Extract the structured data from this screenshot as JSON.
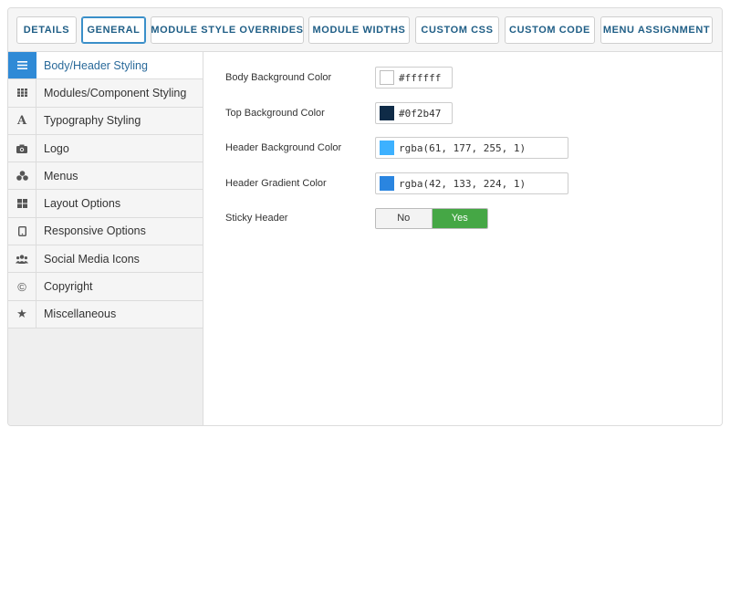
{
  "tabs": [
    {
      "label": "Details"
    },
    {
      "label": "General",
      "active": true
    },
    {
      "label": "Module Style Overrides"
    },
    {
      "label": "Module Widths"
    },
    {
      "label": "Custom CSS"
    },
    {
      "label": "Custom Code"
    },
    {
      "label": "Menu Assignment"
    }
  ],
  "sidebar": {
    "items": [
      {
        "label": "Body/Header Styling",
        "icon": "hamburger-icon",
        "active": true
      },
      {
        "label": "Modules/Component Styling",
        "icon": "grid-icon"
      },
      {
        "label": "Typography Styling",
        "icon": "font-icon"
      },
      {
        "label": "Logo",
        "icon": "camera-icon"
      },
      {
        "label": "Menus",
        "icon": "cubes-icon"
      },
      {
        "label": "Layout Options",
        "icon": "layout-icon"
      },
      {
        "label": "Responsive Options",
        "icon": "tablet-icon"
      },
      {
        "label": "Social Media Icons",
        "icon": "users-icon"
      },
      {
        "label": "Copyright",
        "icon": "copyright-icon"
      },
      {
        "label": "Miscellaneous",
        "icon": "star-icon"
      }
    ]
  },
  "form": {
    "body_bg": {
      "label": "Body Background Color",
      "value": "#ffffff",
      "swatch": "#ffffff"
    },
    "top_bg": {
      "label": "Top Background Color",
      "value": "#0f2b47",
      "swatch": "#0f2b47"
    },
    "header_bg": {
      "label": "Header Background Color",
      "value": "rgba(61, 177, 255, 1)",
      "swatch": "#3db1ff"
    },
    "header_gradient": {
      "label": "Header Gradient Color",
      "value": "rgba(42, 133, 224, 1)",
      "swatch": "#2a85e0"
    },
    "sticky_header": {
      "label": "Sticky Header",
      "off_label": "No",
      "on_label": "Yes",
      "selected": "Yes"
    }
  },
  "colors": {
    "accent": "#2f8ad6",
    "tab_text": "#1f5e86",
    "toggle_on": "#45a745"
  }
}
